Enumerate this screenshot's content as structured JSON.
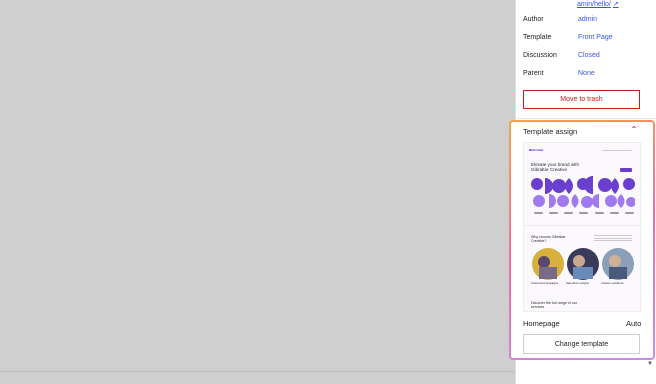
{
  "sidebar": {
    "slug_link": "amin/hello/",
    "rows": [
      {
        "label": "Author",
        "value": "admin"
      },
      {
        "label": "Template",
        "value": "Front Page"
      },
      {
        "label": "Discussion",
        "value": "Closed"
      },
      {
        "label": "Parent",
        "value": "None"
      }
    ],
    "trash_button": "Move to trash"
  },
  "template_panel": {
    "title": "Template assign",
    "template_name": "Homepage",
    "template_mode": "Auto",
    "change_button": "Change template",
    "preview": {
      "logo": "Gibraltar",
      "headline": "Elevate your brand with Gibraltar Creative",
      "section_heading": "Why choose Gibraltar Creative?",
      "captions": [
        "Customized campaigns",
        "Data-driven insights",
        "Creative excellence"
      ],
      "bottom_heading": "Discover the full range of our services"
    }
  },
  "colors": {
    "accent": "#3858e9",
    "danger": "#cc1818",
    "preview_purple": "#6a3fd0"
  }
}
